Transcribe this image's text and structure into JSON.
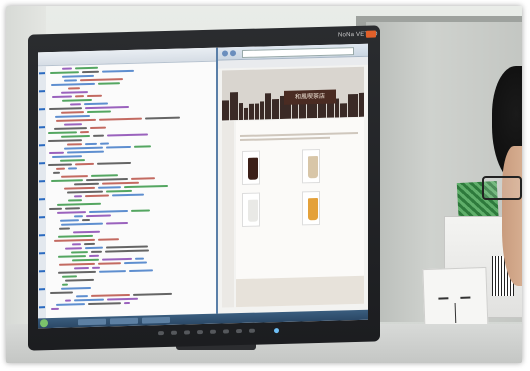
{
  "monitor": {
    "brand": "NoNa VETRO",
    "brand_logo": "orange-logo",
    "power_led_color": "#6fbff5"
  },
  "editor": {
    "toolbar_text": "",
    "accent": "#2a6ac0",
    "code_colors": [
      "#2a6ac0",
      "#7a2fa8",
      "#1c8a2e",
      "#333333",
      "#b03a2e"
    ]
  },
  "browser": {
    "sign": "和風喫茶店",
    "heading": "",
    "products": [
      {
        "name": "",
        "price": "",
        "cup_color": "#3b1f18"
      },
      {
        "name": "",
        "price": "",
        "cup_color": "#d8c6a8"
      },
      {
        "name": "",
        "price": "",
        "cup_color": "#e9e9e6"
      },
      {
        "name": "",
        "price": "",
        "cup_color": "#e4a13a"
      }
    ],
    "banner_color": "#d9d5cf",
    "sign_color": "#4a2b22"
  }
}
